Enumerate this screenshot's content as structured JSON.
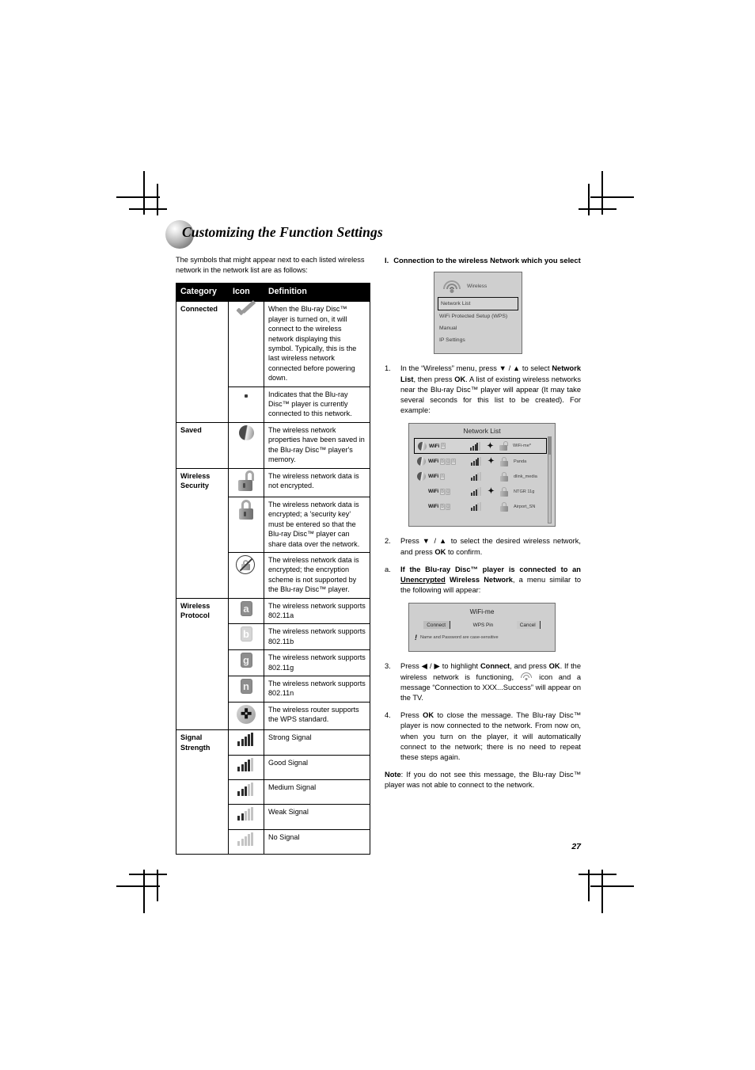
{
  "chapter": {
    "title": "Customizing the Function Settings"
  },
  "page_number": "27",
  "left": {
    "intro": "The symbols that might appear next to each listed wireless network in the network list are as follows:",
    "table": {
      "headers": [
        "Category",
        "Icon",
        "Definition"
      ],
      "rows": [
        {
          "category": "Connected",
          "icon": "checkmark-icon",
          "definition": "When the Blu-ray Disc™ player is turned on, it will connect to the wireless network displaying this symbol. Typically, this is the last wireless network connected before powering down."
        },
        {
          "category": "",
          "icon": "dot-marker-icon",
          "definition": "Indicates that the Blu-ray Disc™ player is currently connected to this network."
        },
        {
          "category": "Saved",
          "icon": "sphere-icon",
          "definition": "The wireless network properties have been saved in the Blu-ray Disc™ player's memory."
        },
        {
          "category": "Wireless Security",
          "icon": "open-lock-icon",
          "definition": "The wireless network data is not encrypted."
        },
        {
          "category": "",
          "icon": "closed-lock-icon",
          "definition": "The wireless network data is encrypted; a 'security key' must be entered so that the Blu-ray Disc™ player can share data over the network."
        },
        {
          "category": "",
          "icon": "no-lock-icon",
          "definition": "The wireless network data is encrypted; the encryption scheme is not supported by the Blu-ray Disc™ player."
        },
        {
          "category": "Wireless Protocol",
          "icon": "protocol-a-icon",
          "definition": "The wireless network supports 802.11a"
        },
        {
          "category": "",
          "icon": "protocol-b-icon",
          "definition": "The wireless network supports 802.11b"
        },
        {
          "category": "",
          "icon": "protocol-g-icon",
          "definition": "The wireless network supports 802.11g"
        },
        {
          "category": "",
          "icon": "protocol-n-icon",
          "definition": "The wireless network supports 802.11n"
        },
        {
          "category": "",
          "icon": "wps-icon",
          "definition": "The wireless router supports the WPS standard."
        },
        {
          "category": "Signal Strength",
          "icon": "signal-strong-icon",
          "bars": 5,
          "definition": "Strong Signal"
        },
        {
          "category": "",
          "icon": "signal-good-icon",
          "bars": 4,
          "definition": "Good Signal"
        },
        {
          "category": "",
          "icon": "signal-medium-icon",
          "bars": 3,
          "definition": "Medium Signal"
        },
        {
          "category": "",
          "icon": "signal-weak-icon",
          "bars": 2,
          "definition": "Weak Signal"
        },
        {
          "category": "",
          "icon": "signal-none-icon",
          "bars": 0,
          "definition": "No Signal"
        }
      ]
    }
  },
  "right": {
    "section": {
      "num": "I.",
      "title": "Connection to the wireless Network which you select"
    },
    "wireless_screen": {
      "header_label": "Wireless",
      "items": [
        {
          "label": "Network List",
          "selected": true
        },
        {
          "label": "WiFi Protected Setup (WPS)",
          "selected": false
        },
        {
          "label": "Manual",
          "selected": false
        },
        {
          "label": "IP Settings",
          "selected": false
        }
      ]
    },
    "steps": [
      {
        "num": "1.",
        "html": "In the “Wireless” menu, press ▼ / ▲ to select <b>Network List</b>, then press <b>OK</b>. A list of existing wireless networks near the Blu-ray Disc™ player will appear (It may take several seconds for this list to be created). For example:"
      },
      {
        "num": "2.",
        "html": "Press ▼ / ▲ to select the desired wireless network, and press <b>OK</b> to confirm."
      }
    ],
    "substep_a": {
      "num": "a.",
      "html": "<b>If the Blu-ray Disc™ player is connected to an <u>Unencrypted</u> Wireless Network</b>, a menu similar to the following will appear:"
    },
    "network_list": {
      "title": "Network List",
      "rows": [
        {
          "name": "WiFi-me*",
          "wifi_label": "WiFi",
          "saved": true,
          "badges": [
            "n"
          ],
          "bars": 4,
          "wps": true,
          "lock": "open",
          "selected": true
        },
        {
          "name": "Panda",
          "wifi_label": "WiFi",
          "saved": true,
          "badges": [
            "b",
            "g",
            "n"
          ],
          "bars": 4,
          "wps": true,
          "lock": "closed",
          "selected": false
        },
        {
          "name": "dlink_media",
          "wifi_label": "WiFi",
          "saved": true,
          "badges": [
            "n"
          ],
          "bars": 3,
          "wps": false,
          "lock": "closed",
          "selected": false
        },
        {
          "name": "NTGR 11g",
          "wifi_label": "WiFi",
          "saved": false,
          "badges": [
            "b",
            "g"
          ],
          "bars": 3,
          "wps": true,
          "lock": "closed",
          "selected": false
        },
        {
          "name": "Airport_SN",
          "wifi_label": "WiFi",
          "saved": false,
          "badges": [
            "b",
            "g"
          ],
          "bars": 3,
          "wps": false,
          "lock": "closed",
          "selected": false
        }
      ]
    },
    "dialog": {
      "title": "WiFi-me",
      "buttons": [
        "Connect",
        "WPS Pin",
        "Cancel"
      ],
      "note": "Name and Password are case-sensitive"
    },
    "steps2": [
      {
        "num": "3.",
        "html": "Press ◀ / ▶ to highlight <b>Connect</b>, and press <b>OK</b>. If the wireless network is functioning, <span class=\"wifi-slot\"></span> icon and a message “Connection to XXX...Success” will appear on the TV."
      },
      {
        "num": "4.",
        "html": "Press <b>OK</b> to close the message. The Blu-ray Disc™ player is now connected to the network. From now on, when you turn on the player, it will automatically connect to the network; there is no need to repeat these steps again."
      }
    ],
    "note": {
      "html": "<b>Note</b>: If you do not see this message, the Blu-ray Disc™ player was not able to connect to the network."
    }
  }
}
